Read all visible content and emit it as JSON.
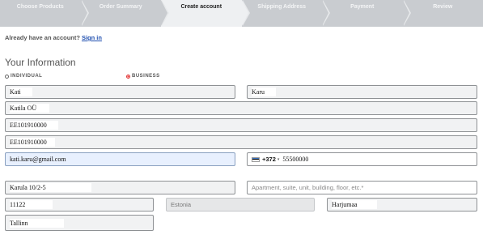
{
  "steps": [
    {
      "label": "Choose Products",
      "active": false
    },
    {
      "label": "Order Summary",
      "active": false
    },
    {
      "label": "Create account",
      "active": true
    },
    {
      "label": "Shipping Address",
      "active": false
    },
    {
      "label": "Payment",
      "active": false
    },
    {
      "label": "Review",
      "active": false
    }
  ],
  "account": {
    "prompt": "Already have an account?",
    "sign_in": "Sign in"
  },
  "section_title": "Your Information",
  "customer_type": {
    "individual": "INDIVIDUAL",
    "business": "BUSINESS",
    "selected": "business"
  },
  "form": {
    "first_name": "Kati",
    "last_name": "Karu",
    "company": "Katila OÜ",
    "reg_code": "EE101910000",
    "vat_number": "EE101910000",
    "email": "kati.karu@gmail.com",
    "phone_code": "+372",
    "phone_number": "55500000",
    "address": "Karula 10/2-5",
    "address2_placeholder": "Apartment, suite, unit, building, floor, etc.*",
    "postal_code": "11122",
    "country": "Estonia",
    "region": "Harjumaa",
    "city": "Tallinn"
  },
  "colors": {
    "accent_link": "#1f4fb0",
    "radio_selected": "#e33333",
    "email_bg": "#e8f0fe"
  }
}
